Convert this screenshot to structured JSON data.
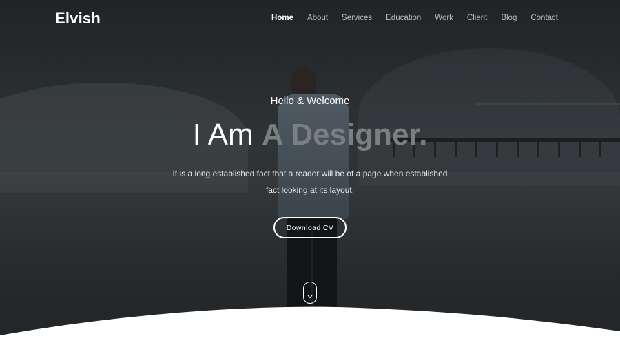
{
  "brand": {
    "logo": "Elvish"
  },
  "nav": {
    "items": [
      {
        "label": "Home",
        "active": true
      },
      {
        "label": "About",
        "active": false
      },
      {
        "label": "Services",
        "active": false
      },
      {
        "label": "Education",
        "active": false
      },
      {
        "label": "Work",
        "active": false
      },
      {
        "label": "Client",
        "active": false
      },
      {
        "label": "Blog",
        "active": false
      },
      {
        "label": "Contact",
        "active": false
      }
    ]
  },
  "hero": {
    "greeting": "Hello & Welcome",
    "headline_prefix": "I Am",
    "headline_highlight": "A Designer.",
    "description": "It is a long established fact that a reader will be of a page when established fact looking at its layout.",
    "cta_label": "Download CV",
    "scroll_icon": "chevron-down-icon"
  },
  "colors": {
    "overlay": "#2b2f32",
    "text": "#ffffff",
    "nav_inactive": "#b9bcbe",
    "headline_highlight": "#7a7f82",
    "wave": "#ffffff"
  }
}
